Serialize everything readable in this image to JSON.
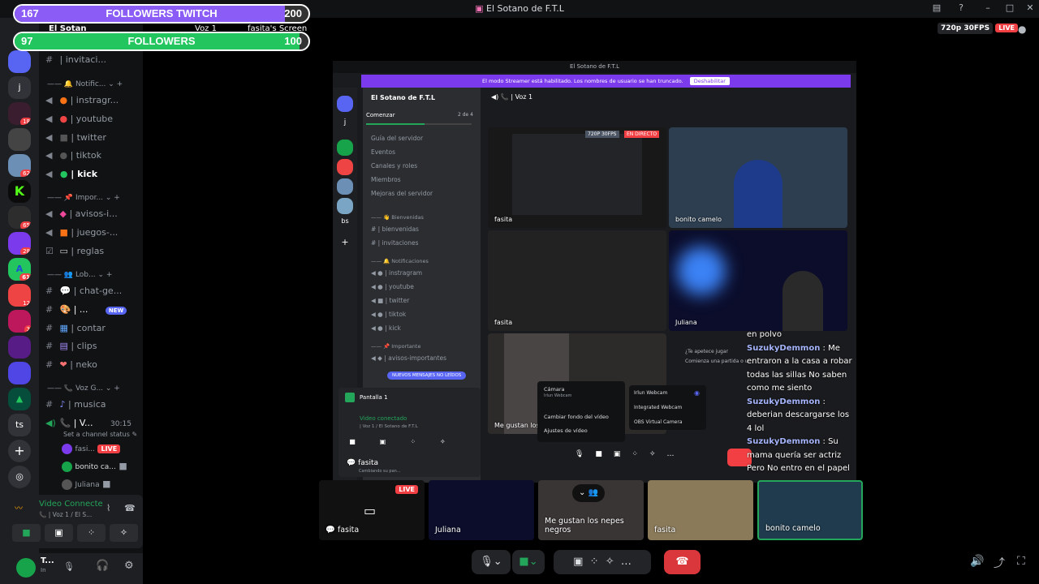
{
  "window": {
    "title": "El Sotano de F.T.L"
  },
  "followers": [
    {
      "min": "167",
      "label": "FOLLOWERS TWITCH",
      "max": "200",
      "progress": 0.92,
      "color": "#8b5cf6"
    },
    {
      "min": "97",
      "label": "FOLLOWERS",
      "max": "100",
      "progress": 0.97,
      "color": "#22c55e"
    }
  ],
  "server_header": {
    "name": "El Sotan",
    "voice": "Voz 1",
    "screen": "fasita's Screen"
  },
  "servers": [
    "j",
    "ts"
  ],
  "server_badges": [
    "18",
    "62",
    "65",
    "28",
    "61",
    "12",
    "3"
  ],
  "categories": {
    "notif": "Notific...",
    "important": "Impor...",
    "lobby": "Lob...",
    "voice": "Voz G..."
  },
  "channels": {
    "invit": "| invitaci...",
    "insta": "| instragr...",
    "yt": "| youtube",
    "tw": "| twitter",
    "tt": "| tiktok",
    "kick": "| kick",
    "avisos": "| avisos-i...",
    "juegos": "| juegos-...",
    "reglas": "| reglas",
    "chat": "| chat-ge...",
    "dots": "| ...",
    "contar": "| contar",
    "clips": "| clips",
    "neko": "| neko",
    "musica": "| musica",
    "voz": "| V...",
    "voz_time": "30:15",
    "set_status": "Set a channel status"
  },
  "new_badge": "NEW",
  "voice_users": [
    {
      "name": "fasi...",
      "live": "LIVE"
    },
    {
      "name": "bonito ca..."
    },
    {
      "name": "Juliana"
    }
  ],
  "voice_panel": {
    "status": "Video Connecte",
    "sub": "| Voz 1 / El S..."
  },
  "user_panel": {
    "name": "T...",
    "status": "In"
  },
  "stream_info": {
    "quality": "720p 30FPS",
    "live": "LIVE"
  },
  "inner": {
    "title": "El Sotano de F.T.L",
    "banner": "El modo Streamer está habilitado. Los nombres de usuario se han truncado.",
    "banner_btn": "Deshabilitar",
    "server": "El Sotano de F.T.L",
    "voice": "Voz 1",
    "start": "Comenzar",
    "start_count": "2 de 4",
    "menu": [
      "Guía del servidor",
      "Eventos",
      "Canales y roles",
      "Miembros",
      "Mejoras del servidor"
    ],
    "cat_welcome": "Bienvenidas",
    "ch_welcome": [
      "| bienvenidas",
      "| invitaciones"
    ],
    "cat_notif": "Notificaciones",
    "ch_notif": [
      "| instragram",
      "| youtube",
      "| twitter",
      "| tiktok",
      "| kick"
    ],
    "cat_imp": "Importante",
    "ch_imp": "| avisos-importantes",
    "new_msgs": "NUEVOS MENSAJES NO LEÍDOS",
    "pantalla": "Pantalla 1",
    "video_connected": "Video conectado",
    "voice_path": "| Voz 1 / El Sotano de F.T.L",
    "user": "fasita",
    "user_sub": "Cambiando su pan...",
    "stream_badge": "720P 30FPS",
    "stream_live": "EN DIRECTO",
    "tiles": [
      "fasita",
      "bonito camelo",
      "fasita",
      "Juliana",
      "Me gustan los n"
    ],
    "cam_menu": {
      "camera": "Cámara",
      "camera_sub": "Irlun Webcam",
      "bg": "Cambiar fondo del vídeo",
      "settings": "Ajustes de vídeo",
      "opts": [
        "Irlun Webcam",
        "Integrated Webcam",
        "OBS Virtual Camera"
      ]
    },
    "game_prompt1": "¿Te apetece jugar",
    "game_prompt2": "Comienza una partida o u"
  },
  "chat": [
    {
      "user": "",
      "text": "en polvo"
    },
    {
      "user": "SuzukyDemmon",
      "text": "Me entraron a la casa a robar todas las sillas No saben como me siento"
    },
    {
      "user": "SuzukyDemmon",
      "text": "deberian descargarse los 4 lol"
    },
    {
      "user": "SuzukyDemmon",
      "text": "Su mama quería ser actriz Pero No entro en el papel"
    }
  ],
  "strip": [
    {
      "name": "fasita",
      "live": "LIVE"
    },
    {
      "name": "Juliana"
    },
    {
      "name": "Me gustan los nepes negros"
    },
    {
      "name": "fasita"
    },
    {
      "name": "bonito camelo"
    }
  ]
}
